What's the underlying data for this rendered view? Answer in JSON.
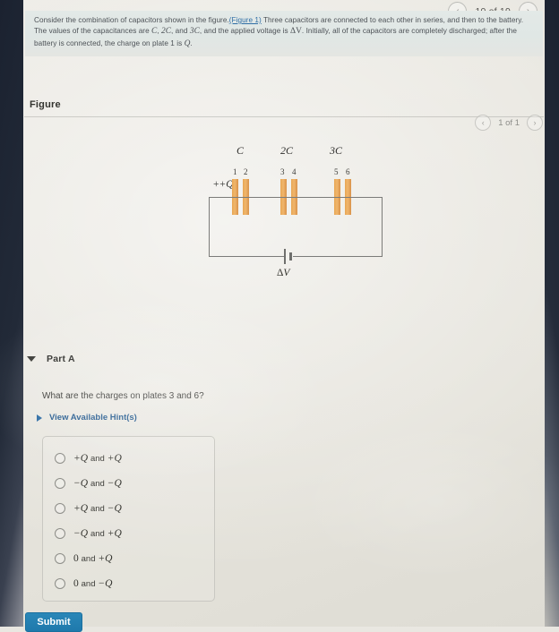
{
  "topnav": {
    "prev_icon": "chevron-left-icon",
    "counter": "10 of 19",
    "next_icon": "chevron-right-icon"
  },
  "question": {
    "text_part1": "Consider the combination of capacitors shown in the figure.",
    "figure_link": "(Figure 1)",
    "text_part2": " Three capacitors are connected to each other in series, and then to the battery. The values of the capacitances are ",
    "cap1": "C",
    "cap_sep1": ", ",
    "cap2": "2C",
    "cap_sep2": ", and ",
    "cap3": "3C",
    "text_part3": ", and the applied voltage is ",
    "voltage": "ΔV",
    "text_part4": ". Initially, all of the capacitors are completely discharged; after the battery is connected, the charge on plate 1 is ",
    "charge": "Q",
    "text_part5": "."
  },
  "figure_section": {
    "heading": "Figure",
    "prev_icon": "chevron-left-icon",
    "counter": "1 of 1",
    "next_icon": "chevron-right-icon"
  },
  "circuit": {
    "capacitor_labels": [
      "C",
      "2C",
      "3C"
    ],
    "plate_numbers": [
      "1",
      "2",
      "3",
      "4",
      "5",
      "6"
    ],
    "charge_label": "+Q",
    "battery_label": "ΔV",
    "plate_color": "#e8a653",
    "wire_color": "#7b7b79"
  },
  "part_a": {
    "title": "Part A",
    "caret_icon": "caret-down-icon",
    "prompt": "What are the charges on plates 3 and 6?",
    "hints_caret_icon": "caret-right-icon",
    "hints_label": "View Available Hint(s)",
    "options": [
      {
        "left": "+Q",
        "conj": "and",
        "right": "+Q"
      },
      {
        "left": "−Q",
        "conj": "and",
        "right": "−Q"
      },
      {
        "left": "+Q",
        "conj": "and",
        "right": "−Q"
      },
      {
        "left": "−Q",
        "conj": "and",
        "right": "+Q"
      },
      {
        "left": "0",
        "conj": "and",
        "right": "+Q"
      },
      {
        "left": "0",
        "conj": "and",
        "right": "−Q"
      }
    ],
    "submit_label": "Submit"
  }
}
